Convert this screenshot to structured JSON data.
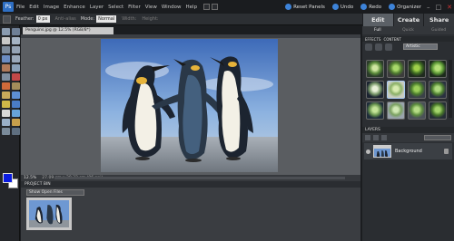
{
  "menubar": {
    "items": [
      "File",
      "Edit",
      "Image",
      "Enhance",
      "Layer",
      "Select",
      "Filter",
      "View",
      "Window",
      "Help"
    ],
    "actions": {
      "reset_panels": "Reset Panels",
      "undo": "Undo",
      "redo": "Redo",
      "organizer": "Organizer"
    }
  },
  "options_bar": {
    "feather_label": "Feather:",
    "feather_value": "0 px",
    "anti_alias": "Anti-alias",
    "mode_label": "Mode:",
    "mode_value": "Normal",
    "width_label": "Width:",
    "height_label": "Height:"
  },
  "document": {
    "tab_title": "Penguins.jpg @ 12.5% (RGB/8*)",
    "zoom": "12.5%",
    "info": "27.09 cm x 20.32 cm (96 ppi)"
  },
  "project_bin": {
    "title": "PROJECT BIN",
    "show_select": "Show Open Files"
  },
  "right_panel": {
    "tabs": [
      "Edit",
      "Create",
      "Share"
    ],
    "subtabs": [
      "Full",
      "Quick",
      "Guided"
    ],
    "effects_title": "EFFECTS",
    "content_title": "CONTENT",
    "effects_dropdown": "Artistic",
    "layers_title": "LAYERS",
    "layer_name": "Background"
  },
  "colors": {
    "foreground": "#0a1be0",
    "background": "#ffffff",
    "accent": "#3d83d9"
  }
}
